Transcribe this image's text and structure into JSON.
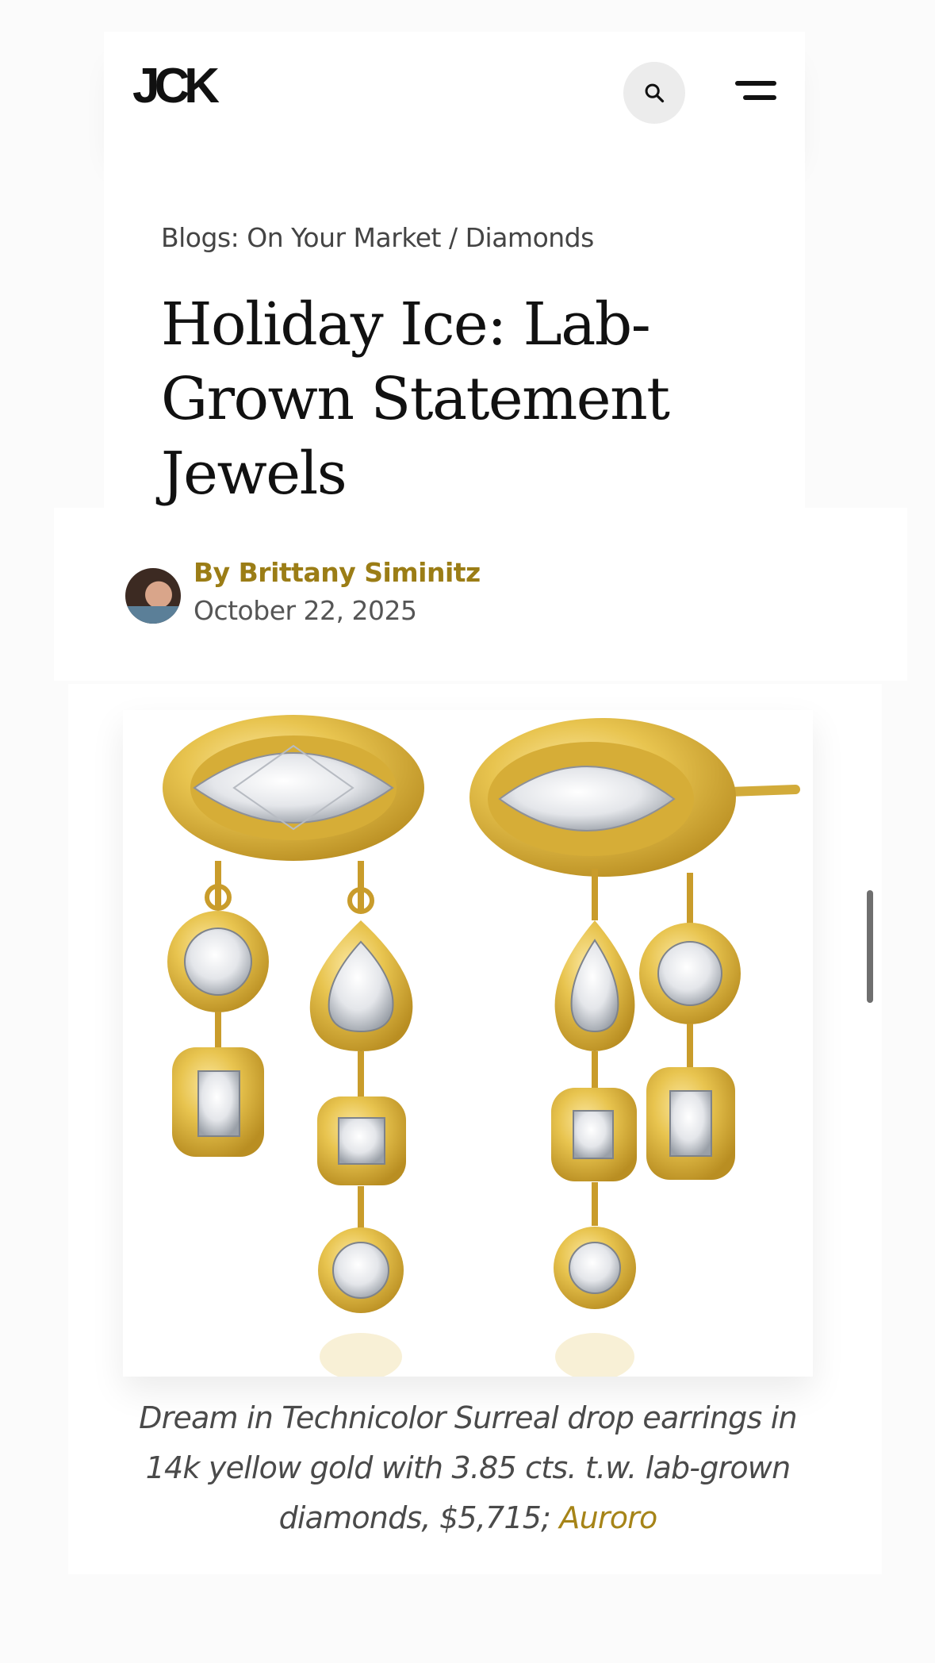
{
  "header": {
    "logo": "JCK",
    "search_icon": "search-icon",
    "menu_icon": "hamburger-menu-icon"
  },
  "article": {
    "breadcrumb": {
      "section": "Blogs: On Your Market",
      "separator": "/",
      "category": "Diamonds"
    },
    "title": "Holiday Ice: Lab-Grown Statement Jewels",
    "author": "By Brittany Siminitz",
    "date": "October 22, 2025"
  },
  "figure": {
    "alt": "gold earrings with lab-grown diamonds",
    "caption_text": "Dream in Technicolor Surreal drop earrings in 14k yellow gold with 3.85 cts. t.w. lab-grown diamonds, $5,715;",
    "caption_link": "Auroro"
  },
  "colors": {
    "accent_gold": "#9b7d16",
    "gold_metal": "#e6c24f",
    "text_dark": "#111111"
  }
}
